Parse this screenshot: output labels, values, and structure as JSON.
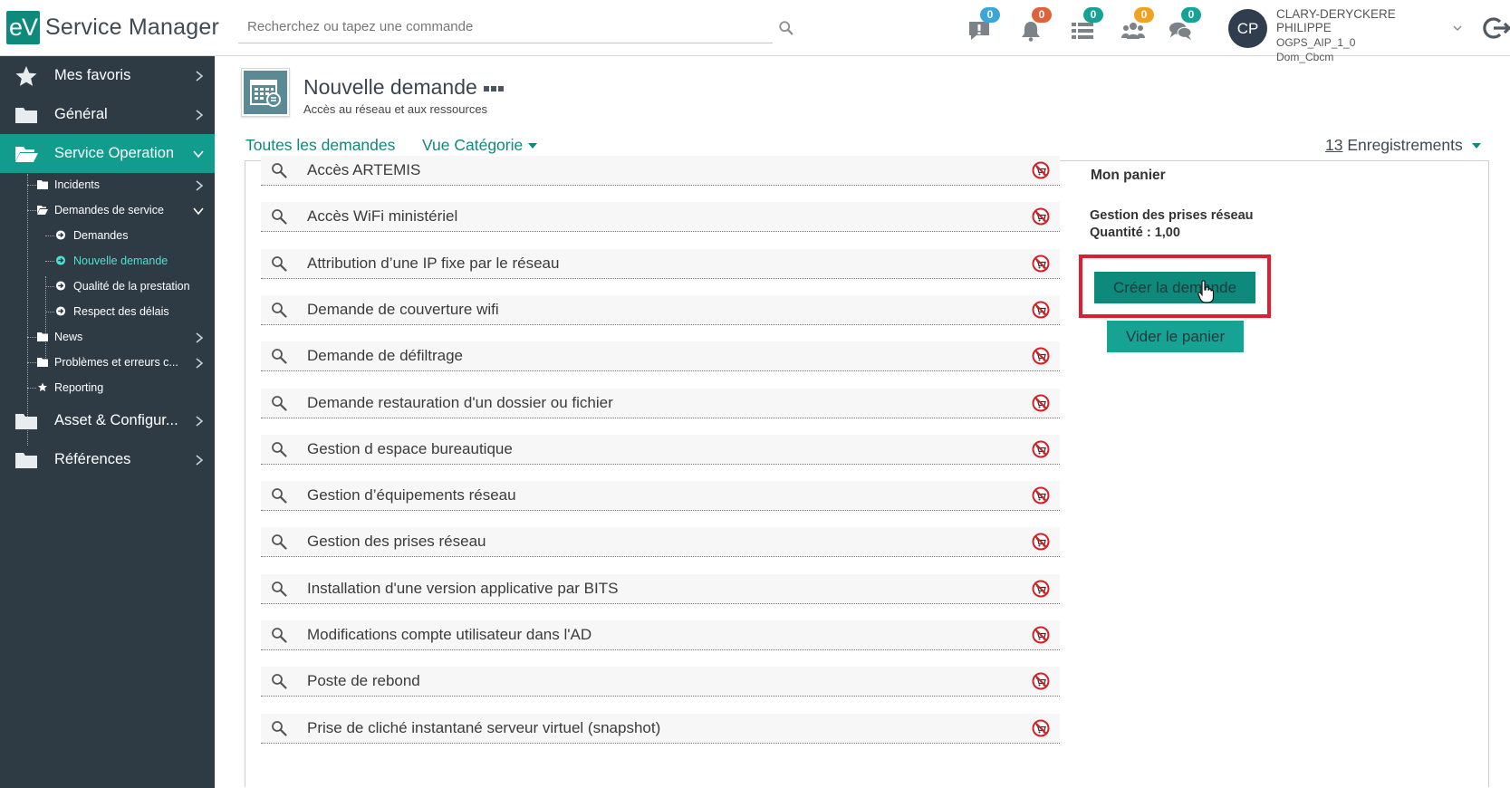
{
  "app": {
    "logo_badge": "eV",
    "name": "Service Manager"
  },
  "search": {
    "placeholder": "Recherchez ou tapez une commande"
  },
  "notifications": [
    {
      "name": "alerts",
      "icon": "alert-comment-icon",
      "count": "0",
      "color": "#3aa7d8"
    },
    {
      "name": "bell",
      "icon": "bell-icon",
      "count": "0",
      "color": "#e0623a"
    },
    {
      "name": "tasks",
      "icon": "list-icon",
      "count": "0",
      "color": "#16a396"
    },
    {
      "name": "teams",
      "icon": "users-icon",
      "count": "0",
      "color": "#f2a223"
    },
    {
      "name": "chat",
      "icon": "chat-icon",
      "count": "0",
      "color": "#16a396"
    }
  ],
  "user": {
    "initials": "CP",
    "name": "CLARY-DERYCKERE PHILIPPE",
    "group": "OGPS_AIP_1_0",
    "domain": "Dom_Cbcm"
  },
  "sidebar": {
    "items": [
      {
        "label": "Mes favoris",
        "icon": "star-icon"
      },
      {
        "label": "Général",
        "icon": "folder-icon"
      },
      {
        "label": "Service Operation",
        "icon": "folder-open-icon",
        "active": true
      },
      {
        "label": "Asset & Configur...",
        "icon": "folder-icon"
      },
      {
        "label": "Références",
        "icon": "folder-icon"
      }
    ],
    "subitems": [
      {
        "label": "Incidents",
        "icon": "folder-icon"
      },
      {
        "label": "Demandes de service",
        "icon": "folder-open-icon"
      },
      {
        "label": "Demandes",
        "icon": "arrow-circle-icon"
      },
      {
        "label": "Nouvelle demande",
        "icon": "arrow-circle-icon",
        "highlight": true
      },
      {
        "label": "Qualité de la prestation",
        "icon": "arrow-circle-icon"
      },
      {
        "label": "Respect des délais",
        "icon": "arrow-circle-icon"
      },
      {
        "label": "News",
        "icon": "folder-icon"
      },
      {
        "label": "Problèmes et erreurs c...",
        "icon": "folder-icon"
      },
      {
        "label": "Reporting",
        "icon": "star-icon"
      }
    ]
  },
  "page": {
    "title": "Nouvelle demande",
    "subtitle": "Accès au réseau et aux ressources"
  },
  "views": {
    "all_label": "Toutes les demandes",
    "category_label": "Vue Catégorie",
    "records_count": "13",
    "records_label": "Enregistrements"
  },
  "requests": [
    "Accès ARTEMIS",
    "Accès WiFi ministériel",
    "Attribution d’une IP fixe par le réseau",
    "Demande de couverture wifi",
    "Demande de défiltrage",
    "Demande restauration d'un dossier ou fichier",
    "Gestion d espace bureautique",
    "Gestion d’équipements réseau",
    "Gestion des prises réseau",
    "Installation d'une version applicative par BITS",
    "Modifications compte utilisateur dans l'AD",
    "Poste de rebond",
    "Prise de cliché instantané serveur virtuel (snapshot)"
  ],
  "cart": {
    "title": "Mon panier",
    "item_name": "Gestion des prises réseau",
    "item_quantity": "Quantité : 1,00",
    "create_label": "Créer la demande",
    "empty_label": "Vider le panier"
  },
  "colors": {
    "accent": "#0d8a7c",
    "sidebar_bg": "#2e3b45",
    "sidebar_active": "#119c8d",
    "highlight_frame": "#e01e2f"
  }
}
